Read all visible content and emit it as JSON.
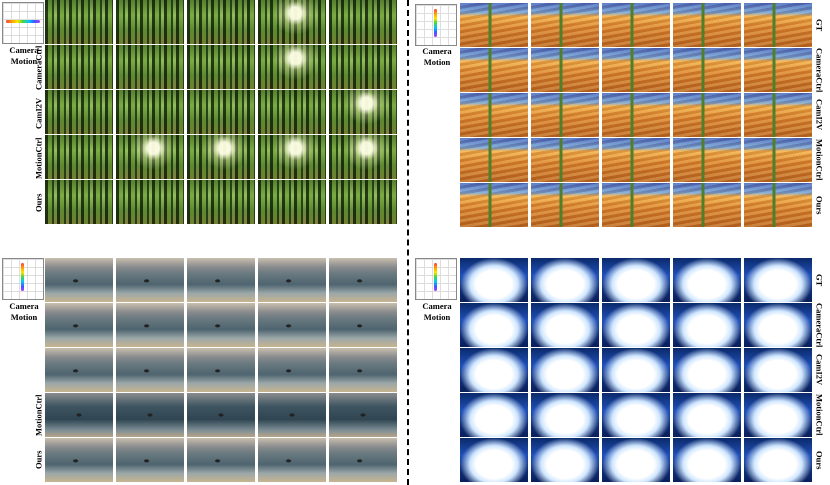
{
  "camera_label": "Camera\nMotion",
  "methods": [
    "GT",
    "CameraCtrl",
    "CamI2V",
    "MotionCtrl",
    "Ours"
  ],
  "panels": [
    {
      "scene": "bamboo-forest",
      "trajectory": "horizontal",
      "label_side": "left"
    },
    {
      "scene": "desert-cactus",
      "trajectory": "vertical",
      "label_side": "right"
    },
    {
      "scene": "lake-boat",
      "trajectory": "vertical",
      "label_side": "left"
    },
    {
      "scene": "iceberg",
      "trajectory": "vertical",
      "label_side": "right"
    }
  ],
  "frames_per_row": 5
}
